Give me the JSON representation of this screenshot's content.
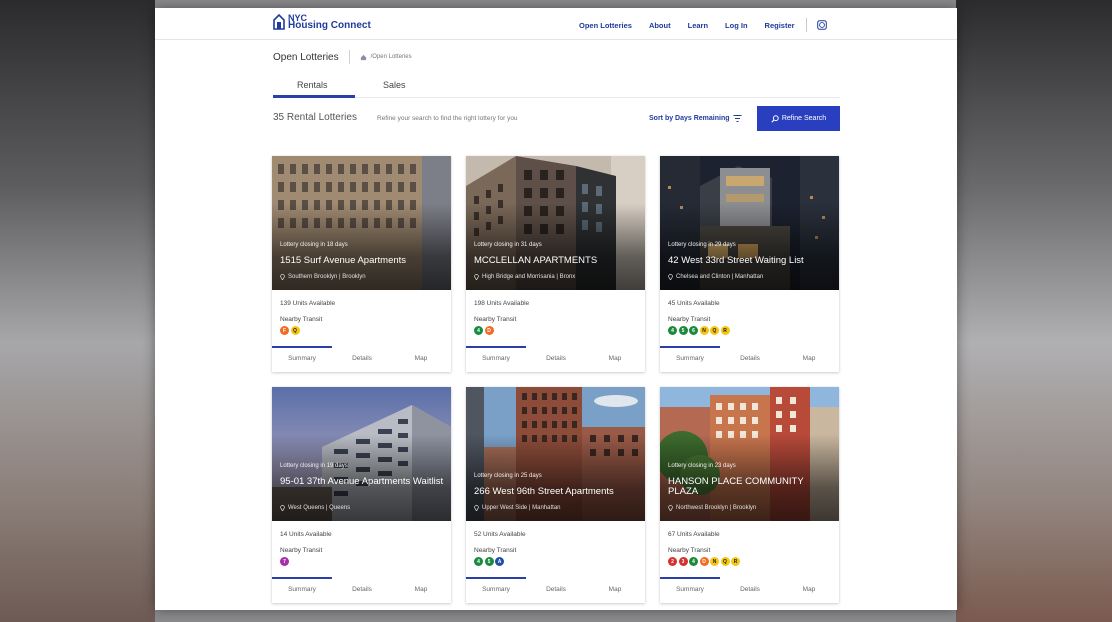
{
  "header": {
    "logo_line1": "NYC",
    "logo_line2": "Housing Connect",
    "nav": [
      "Open Lotteries",
      "About",
      "Learn",
      "Log In",
      "Register"
    ]
  },
  "breadcrumb": {
    "title": "Open Lotteries",
    "home_label": "/Open Lotteries"
  },
  "tabs": [
    "Rentals",
    "Sales"
  ],
  "summary": {
    "count": "35 Rental Lotteries",
    "hint": "Refine your search to find the right lottery for you",
    "sort_label": "Sort by Days Remaining",
    "refine_label": "Refine Search"
  },
  "colors": {
    "brand": "#1f3b9c",
    "button": "#2a3fc0",
    "line_orange": "#f26a23",
    "line_yellow": "#f5c710",
    "line_green": "#1a8a3c",
    "line_blue": "#1f4fa8",
    "line_purple": "#a62ea6",
    "line_red": "#d62f2f"
  },
  "cards": [
    {
      "closing": "Lottery closing in 18 days",
      "name": "1515 Surf Avenue Apartments",
      "location": "Southern Brooklyn | Brooklyn",
      "units": "139 Units Available",
      "transit_label": "Nearby Transit",
      "trains": [
        {
          "l": "F",
          "c": "orange"
        },
        {
          "l": "Q",
          "c": "yellow"
        }
      ],
      "tabs": [
        "Summary",
        "Details",
        "Map"
      ]
    },
    {
      "closing": "Lottery closing in 31 days",
      "name": "MCCLELLAN APARTMENTS",
      "location": "High Bridge and Morrisania | Bronx",
      "units": "198 Units Available",
      "transit_label": "Nearby Transit",
      "trains": [
        {
          "l": "4",
          "c": "green"
        },
        {
          "l": "D",
          "c": "orange"
        }
      ],
      "tabs": [
        "Summary",
        "Details",
        "Map"
      ]
    },
    {
      "closing": "Lottery closing in 29 days",
      "name": "42 West 33rd Street Waiting List",
      "location": "Chelsea and Clinton | Manhattan",
      "units": "45 Units Available",
      "transit_label": "Nearby Transit",
      "trains": [
        {
          "l": "4",
          "c": "green"
        },
        {
          "l": "5",
          "c": "green"
        },
        {
          "l": "6",
          "c": "green"
        },
        {
          "l": "N",
          "c": "yellow"
        },
        {
          "l": "Q",
          "c": "yellow"
        },
        {
          "l": "R",
          "c": "yellow"
        }
      ],
      "tabs": [
        "Summary",
        "Details",
        "Map"
      ]
    },
    {
      "closing": "Lottery closing in 19 days",
      "name": "95-01 37th Avenue Apartments Waitlist",
      "location": "West Queens | Queens",
      "units": "14 Units Available",
      "transit_label": "Nearby Transit",
      "trains": [
        {
          "l": "7",
          "c": "purple"
        }
      ],
      "tabs": [
        "Summary",
        "Details",
        "Map"
      ]
    },
    {
      "closing": "Lottery closing in 25 days",
      "name": "266 West 96th Street Apartments",
      "location": "Upper West Side | Manhattan",
      "units": "52 Units Available",
      "transit_label": "Nearby Transit",
      "trains": [
        {
          "l": "4",
          "c": "green"
        },
        {
          "l": "5",
          "c": "green"
        },
        {
          "l": "A",
          "c": "blue"
        }
      ],
      "tabs": [
        "Summary",
        "Details",
        "Map"
      ]
    },
    {
      "closing": "Lottery closing in 23 days",
      "name": "HANSON PLACE COMMUNITY PLAZA",
      "location": "Northwest Brooklyn | Brooklyn",
      "units": "67 Units Available",
      "transit_label": "Nearby Transit",
      "trains": [
        {
          "l": "2",
          "c": "red"
        },
        {
          "l": "3",
          "c": "red"
        },
        {
          "l": "4",
          "c": "green"
        },
        {
          "l": "D",
          "c": "orange"
        },
        {
          "l": "N",
          "c": "yellow"
        },
        {
          "l": "Q",
          "c": "yellow"
        },
        {
          "l": "R",
          "c": "yellow"
        }
      ],
      "tabs": [
        "Summary",
        "Details",
        "Map"
      ]
    }
  ]
}
